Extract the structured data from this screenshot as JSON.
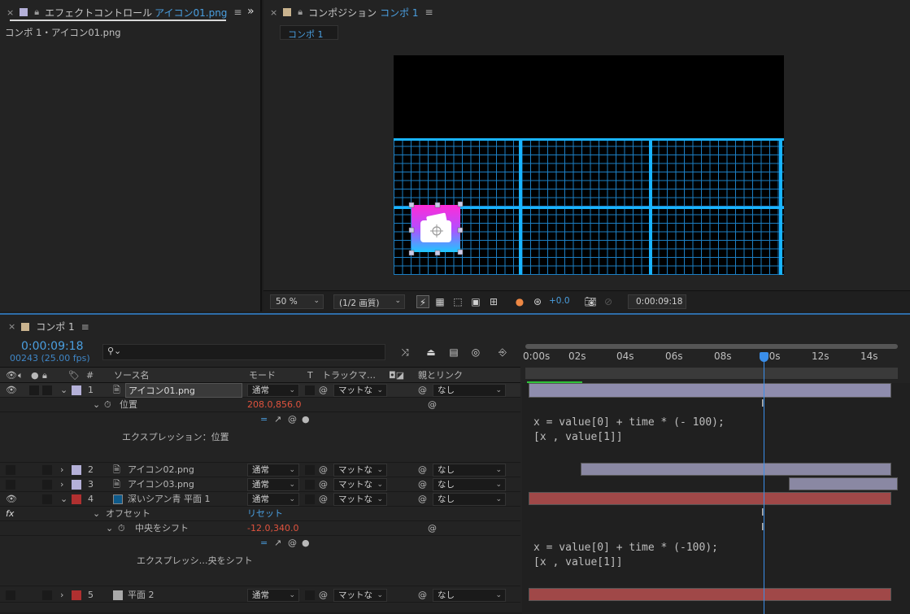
{
  "left_panel": {
    "close": "×",
    "title_prefix": "エフェクトコントロール",
    "title_file": "アイコン01.png",
    "menu": "≡",
    "expand": "»",
    "subtitle": "コンポ 1・アイコン01.png"
  },
  "comp_panel": {
    "close": "×",
    "title_prefix": "コンポジション",
    "title_comp": "コンポ 1",
    "menu": "≡",
    "tab_chip": "コンポ 1",
    "toolbar": {
      "zoom": "50 %",
      "resolution": "(1/2 画質)",
      "exposure": "+0.0",
      "timecode": "0:00:09:18"
    }
  },
  "timeline": {
    "close": "×",
    "tab": "コンポ 1",
    "menu": "≡",
    "timecode": "0:00:09:18",
    "frames": "00243 (25.00 fps)",
    "search_placeholder": "",
    "headers": {
      "num": "#",
      "source": "ソース名",
      "mode": "モード",
      "t": "T",
      "track": "トラックマ…",
      "parent": "親とリンク"
    },
    "ruler": [
      "0:00s",
      "02s",
      "04s",
      "06s",
      "08s",
      "10s",
      "12s",
      "14s"
    ],
    "layers": [
      {
        "num": "1",
        "name": "アイコン01.png",
        "mode": "通常",
        "track": "マットな",
        "parent": "なし",
        "color": "#b4b0d8"
      },
      {
        "num": "2",
        "name": "アイコン02.png",
        "mode": "通常",
        "track": "マットな",
        "parent": "なし",
        "color": "#b4b0d8"
      },
      {
        "num": "3",
        "name": "アイコン03.png",
        "mode": "通常",
        "track": "マットな",
        "parent": "なし",
        "color": "#b4b0d8"
      },
      {
        "num": "4",
        "name": "深いシアン青 平面 1",
        "mode": "通常",
        "track": "マットな",
        "parent": "なし",
        "color": "#b03030"
      },
      {
        "num": "5",
        "name": "平面 2",
        "mode": "通常",
        "track": "マットな",
        "parent": "なし",
        "color": "#b03030"
      }
    ],
    "props": {
      "position_label": "位置",
      "position_value": "208.0,856.0",
      "expr1_label": "エクスプレッション：位置",
      "expr1_line1": "x = value[0] + time * (- 100);",
      "expr1_line2": "[x , value[1]]",
      "fx": "fx",
      "offset_label": "オフセット",
      "reset": "リセット",
      "shift_label": "中央をシフト",
      "shift_value": "-12.0,340.0",
      "expr2_label": "エクスプレッシ…央をシフト",
      "expr2_line1": "x = value[0] + time * (-100);",
      "expr2_line2": "[x , value[1]]"
    },
    "playhead_fraction": 0.65
  }
}
